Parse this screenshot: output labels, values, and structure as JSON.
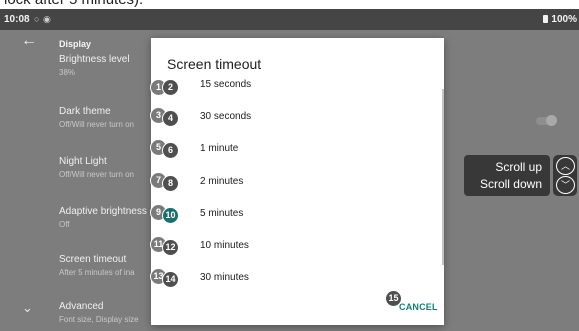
{
  "caption": "lock after 5 minutes).",
  "status": {
    "time": "10:08",
    "battery": "100%"
  },
  "appbar": {
    "title": "Display"
  },
  "settings": [
    {
      "title": "Brightness level",
      "subtitle": "38%"
    },
    {
      "title": "Dark theme",
      "subtitle": "Off/Will never turn on"
    },
    {
      "title": "Night Light",
      "subtitle": "Off/Will never turn on"
    },
    {
      "title": "Adaptive brightness",
      "subtitle": "Off"
    },
    {
      "title": "Screen timeout",
      "subtitle": "After 5 minutes of ina"
    },
    {
      "title": "Advanced",
      "subtitle": "Font size, Display size"
    }
  ],
  "dialog": {
    "title": "Screen timeout",
    "options": [
      {
        "label": "15 seconds",
        "badges": [
          "1",
          "2"
        ]
      },
      {
        "label": "30 seconds",
        "badges": [
          "3",
          "4"
        ]
      },
      {
        "label": "1 minute",
        "badges": [
          "5",
          "6"
        ]
      },
      {
        "label": "2 minutes",
        "badges": [
          "7",
          "8"
        ]
      },
      {
        "label": "5 minutes",
        "badges": [
          "9",
          "10"
        ]
      },
      {
        "label": "10 minutes",
        "badges": [
          "11",
          "12"
        ]
      },
      {
        "label": "30 minutes",
        "badges": [
          "13",
          "14"
        ]
      }
    ],
    "cancel_label": "CANCEL",
    "cancel_badge": "15"
  },
  "scroll_control": {
    "up_label": "Scroll up",
    "down_label": "Scroll down"
  },
  "icons": {
    "back": "back-arrow-icon",
    "expand": "chevron-down-icon",
    "scroll_up": "chevron-up-icon",
    "scroll_down": "chevron-down-icon"
  },
  "colors": {
    "accent": "#1a7b73",
    "scrim": "#7d7d7d",
    "statusbar": "#454545"
  }
}
